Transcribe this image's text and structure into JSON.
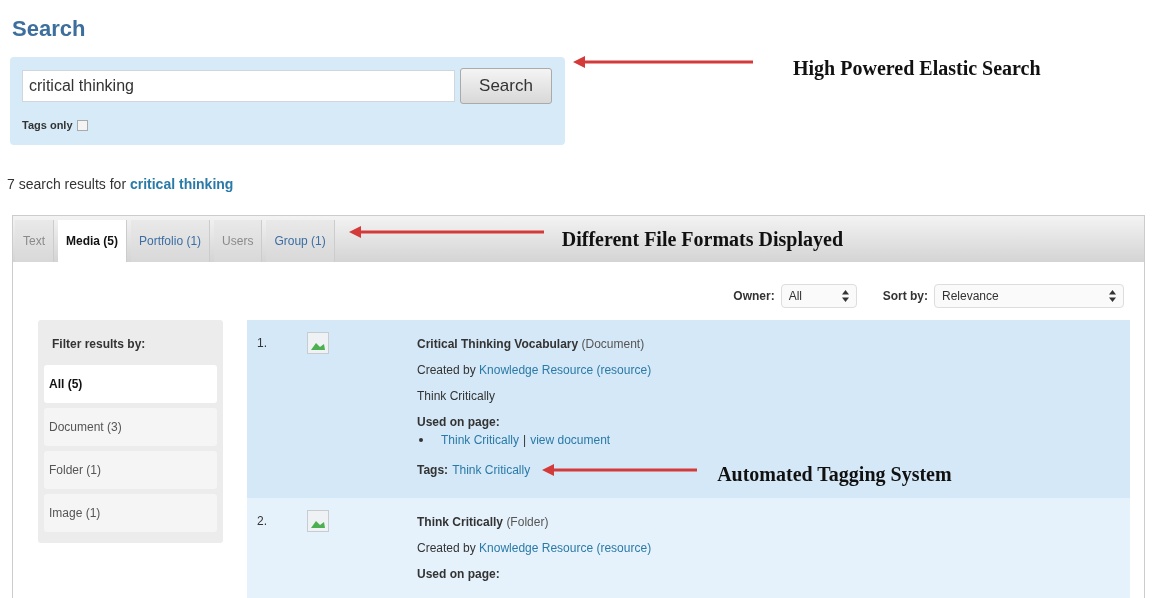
{
  "heading": "Search",
  "search": {
    "value": "critical thinking",
    "button": "Search",
    "tags_only": {
      "label": "Tags only",
      "checked": false
    },
    "annotation": "High Powered Elastic Search"
  },
  "summary": {
    "prefix": "7 search results for",
    "query": "critical thinking"
  },
  "tabs": [
    {
      "label": "Text",
      "selected": false,
      "disabled": true
    },
    {
      "label": "Media (5)",
      "selected": true,
      "disabled": false
    },
    {
      "label": "Portfolio (1)",
      "selected": false,
      "disabled": false
    },
    {
      "label": "Users",
      "selected": false,
      "disabled": true
    },
    {
      "label": "Group (1)",
      "selected": false,
      "disabled": false
    }
  ],
  "tabs_annotation": "Different File Formats Displayed",
  "owner": {
    "label": "Owner:",
    "value": "All"
  },
  "sort": {
    "label": "Sort by:",
    "value": "Relevance"
  },
  "filter": {
    "title": "Filter results by:",
    "items": [
      {
        "label": "All (5)",
        "selected": true
      },
      {
        "label": "Document (3)",
        "selected": false
      },
      {
        "label": "Folder (1)",
        "selected": false
      },
      {
        "label": "Image (1)",
        "selected": false
      }
    ]
  },
  "results": [
    {
      "number": "1.",
      "title": "Critical Thinking Vocabulary",
      "type": "(Document)",
      "created_prefix": "Created by",
      "creator": "Knowledge Resource (resource)",
      "description": "Think Critically",
      "used_on_label": "Used on page:",
      "used_on": [
        {
          "page": "Think Critically",
          "separator": "|",
          "action": "view document"
        }
      ],
      "tags_label": "Tags:",
      "tags": "Think Critically",
      "annotation": "Automated Tagging System"
    },
    {
      "number": "2.",
      "title": "Think Critically",
      "type": "(Folder)",
      "created_prefix": "Created by",
      "creator": "Knowledge Resource (resource)",
      "used_on_label": "Used on page:"
    }
  ]
}
